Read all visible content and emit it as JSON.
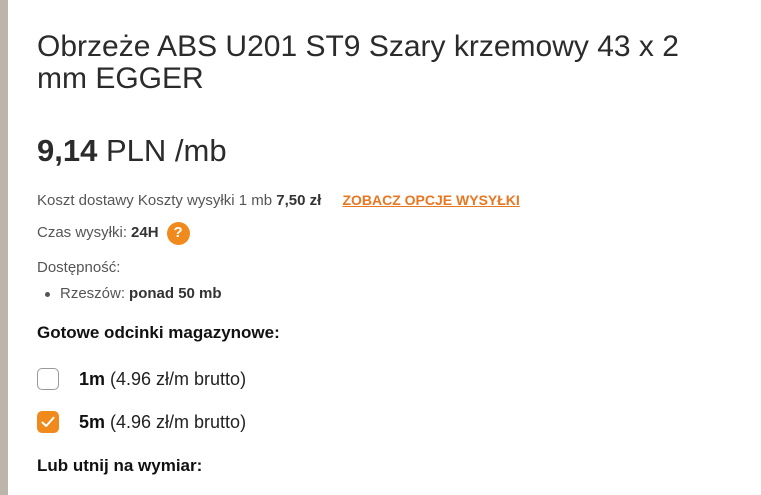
{
  "product": {
    "title": "Obrzeże ABS U201 ST9 Szary krzemowy 43 x 2 mm EGGER"
  },
  "price": {
    "value": "9,14",
    "unit": "PLN /mb"
  },
  "shipping": {
    "label": "Koszt dostawy Koszty wysyłki 1 mb",
    "cost": "7,50 zł",
    "link_label": "ZOBACZ OPCJE WYSYŁKI"
  },
  "dispatch": {
    "label": "Czas wysyłki:",
    "value": "24H",
    "help_icon": "?"
  },
  "availability": {
    "label": "Dostępność:",
    "locations": [
      {
        "name": "Rzeszów:",
        "stock": "ponad 50 mb"
      }
    ]
  },
  "ready_cuts": {
    "heading": "Gotowe odcinki magazynowe:",
    "options": [
      {
        "length": "1m",
        "price": "(4.96 zł/m brutto)",
        "checked": false
      },
      {
        "length": "5m",
        "price": "(4.96 zł/m brutto)",
        "checked": true
      }
    ]
  },
  "custom_cut": {
    "heading": "Lub utnij na wymiar:"
  },
  "colors": {
    "accent": "#f08a1c",
    "link": "#e87722",
    "left_bar": "#bdb5ab"
  }
}
